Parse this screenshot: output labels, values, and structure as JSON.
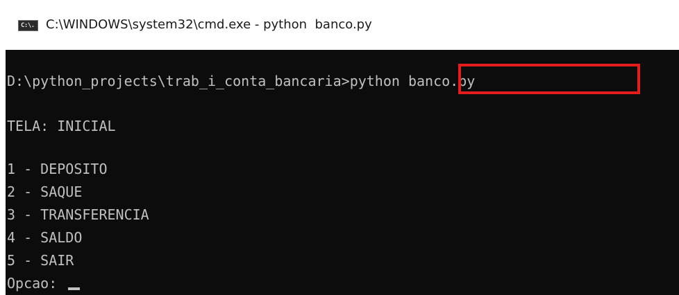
{
  "window": {
    "title": "C:\\WINDOWS\\system32\\cmd.exe - python  banco.py",
    "icon": "cmd-icon",
    "icon_text": "C:\\."
  },
  "console": {
    "prompt": "D:\\python_projects\\trab_i_conta_bancaria>",
    "command": "python banco.py",
    "screen_title": "TELA: INICIAL",
    "menu": [
      "1 - DEPOSITO",
      "2 - SAQUE",
      "3 - TRANSFERENCIA",
      "4 - SALDO",
      "5 - SAIR"
    ],
    "input_prompt": "Opcao: "
  },
  "colors": {
    "console_bg": "#0c0c0c",
    "console_text": "#c0c0c0",
    "highlight": "#e51c1c"
  }
}
